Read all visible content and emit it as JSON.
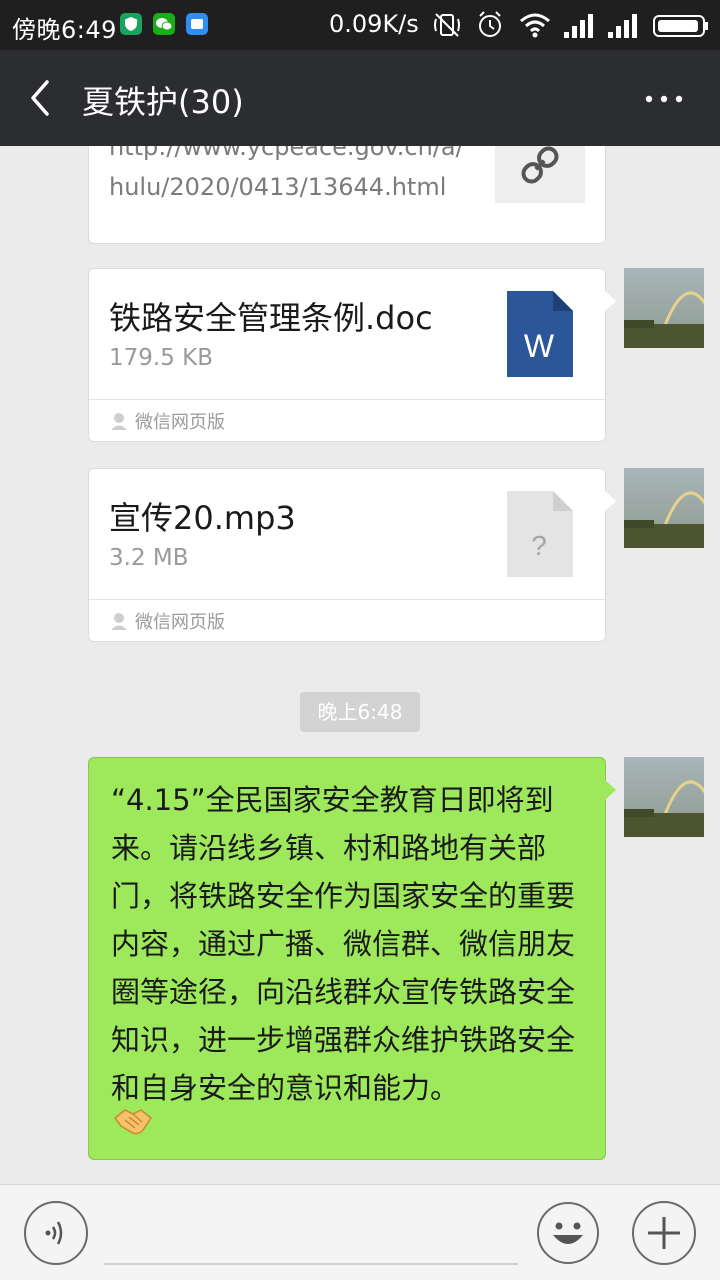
{
  "status_bar": {
    "time": "傍晚6:49",
    "net_speed": "0.09K/s",
    "icons": [
      "shield-app-icon",
      "wechat-app-icon",
      "blue-app-icon",
      "silent-icon",
      "alarm-icon",
      "wifi-icon",
      "signal-icon",
      "signal-icon",
      "battery-icon"
    ]
  },
  "header": {
    "title": "夏铁护(30)"
  },
  "messages": {
    "link": {
      "url_line1": "http://www.ycpeace.gov.cn/a/",
      "url_line2": "hulu/2020/0413/13644.html",
      "icon": "link-icon"
    },
    "file1": {
      "name": "铁路安全管理条例.doc",
      "size": "179.5 KB",
      "icon_letter": "W",
      "source": "微信网页版"
    },
    "file2": {
      "name": "宣传20.mp3",
      "size": "3.2 MB",
      "icon_letter": "?",
      "source": "微信网页版"
    },
    "timestamp": "晚上6:48",
    "text": "“4.15”全民国家安全教育日即将到来。请沿线乡镇、村和路地有关部门，将铁路安全作为国家安全的重要内容，通过广播、微信群、微信朋友圈等途径，向沿线群众宣传铁路安全知识，进一步增强群众维护铁路安全和自身安全的意识和能力。",
    "emoji": "handshake-emoji"
  },
  "colors": {
    "sent_bubble": "#9ee85c",
    "header_bg": "#2c2d31",
    "chat_bg": "#ebebeb",
    "word_blue": "#2b579a"
  }
}
